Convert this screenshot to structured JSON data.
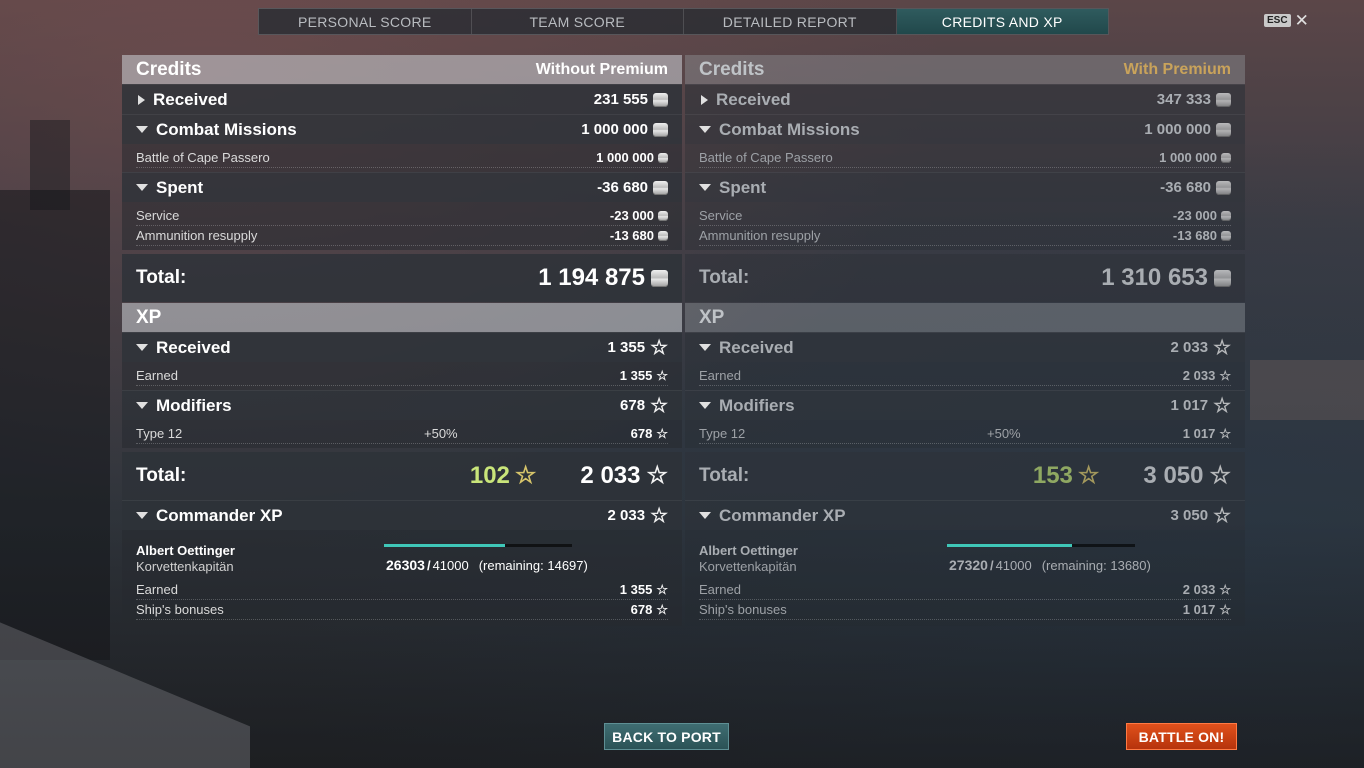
{
  "tabs": [
    {
      "label": "PERSONAL SCORE"
    },
    {
      "label": "TEAM SCORE"
    },
    {
      "label": "DETAILED REPORT"
    },
    {
      "label": "CREDITS AND XP"
    }
  ],
  "active_tab": "CREDITS AND XP",
  "esc_label": "ESC",
  "close_glyph": "✕",
  "icons": {
    "credits": "credit-coin-icon",
    "xp": "xp-star-icon",
    "expand": "triangle-icon"
  },
  "colors": {
    "active_tab": "#2f5b5e",
    "premium_gold": "#c9a35b",
    "bonus_green": "#c9e57a",
    "battle_button": "#d4441a",
    "port_button": "#356065",
    "xp_bar": "#3fc7b8"
  },
  "left": {
    "credits": {
      "title": "Credits",
      "subtitle": "Without Premium",
      "received": {
        "label": "Received",
        "value": "231 555"
      },
      "combat_missions": {
        "label": "Combat Missions",
        "value": "1 000 000",
        "items": [
          {
            "label": "Battle of Cape Passero",
            "value": "1 000 000"
          }
        ]
      },
      "spent": {
        "label": "Spent",
        "value": "-36 680",
        "items": [
          {
            "label": "Service",
            "value": "-23 000"
          },
          {
            "label": "Ammunition resupply",
            "value": "-13 680"
          }
        ]
      },
      "total": {
        "label": "Total:",
        "value": "1 194 875"
      }
    },
    "xp": {
      "title": "XP",
      "received": {
        "label": "Received",
        "value": "1 355",
        "items": [
          {
            "label": "Earned",
            "value": "1 355"
          }
        ]
      },
      "modifiers": {
        "label": "Modifiers",
        "value": "678",
        "items": [
          {
            "label": "Type 12",
            "percent": "+50%",
            "value": "678"
          }
        ]
      },
      "total": {
        "label": "Total:",
        "bonus": "102",
        "value": "2 033"
      },
      "commander": {
        "label": "Commander XP",
        "value": "2 033",
        "name": "Albert Oettinger",
        "rank": "Korvettenkapitän",
        "current": "26303",
        "max": "41000",
        "remaining": "(remaining: 14697)",
        "progress": 0.6415,
        "items": [
          {
            "label": "Earned",
            "value": "1 355"
          },
          {
            "label": "Ship's bonuses",
            "value": "678"
          }
        ]
      }
    }
  },
  "right": {
    "credits": {
      "title": "Credits",
      "subtitle": "With Premium",
      "received": {
        "label": "Received",
        "value": "347 333"
      },
      "combat_missions": {
        "label": "Combat Missions",
        "value": "1 000 000",
        "items": [
          {
            "label": "Battle of Cape Passero",
            "value": "1 000 000"
          }
        ]
      },
      "spent": {
        "label": "Spent",
        "value": "-36 680",
        "items": [
          {
            "label": "Service",
            "value": "-23 000"
          },
          {
            "label": "Ammunition resupply",
            "value": "-13 680"
          }
        ]
      },
      "total": {
        "label": "Total:",
        "value": "1 310 653"
      }
    },
    "xp": {
      "title": "XP",
      "received": {
        "label": "Received",
        "value": "2 033",
        "items": [
          {
            "label": "Earned",
            "value": "2 033"
          }
        ]
      },
      "modifiers": {
        "label": "Modifiers",
        "value": "1 017",
        "items": [
          {
            "label": "Type 12",
            "percent": "+50%",
            "value": "1 017"
          }
        ]
      },
      "total": {
        "label": "Total:",
        "bonus": "153",
        "value": "3 050"
      },
      "commander": {
        "label": "Commander XP",
        "value": "3 050",
        "name": "Albert Oettinger",
        "rank": "Korvettenkapitän",
        "current": "27320",
        "max": "41000",
        "remaining": "(remaining: 13680)",
        "progress": 0.6663,
        "items": [
          {
            "label": "Earned",
            "value": "2 033"
          },
          {
            "label": "Ship's bonuses",
            "value": "1 017"
          }
        ]
      }
    }
  },
  "buttons": {
    "back_to_port": "BACK TO PORT",
    "battle_on": "BATTLE ON!"
  }
}
